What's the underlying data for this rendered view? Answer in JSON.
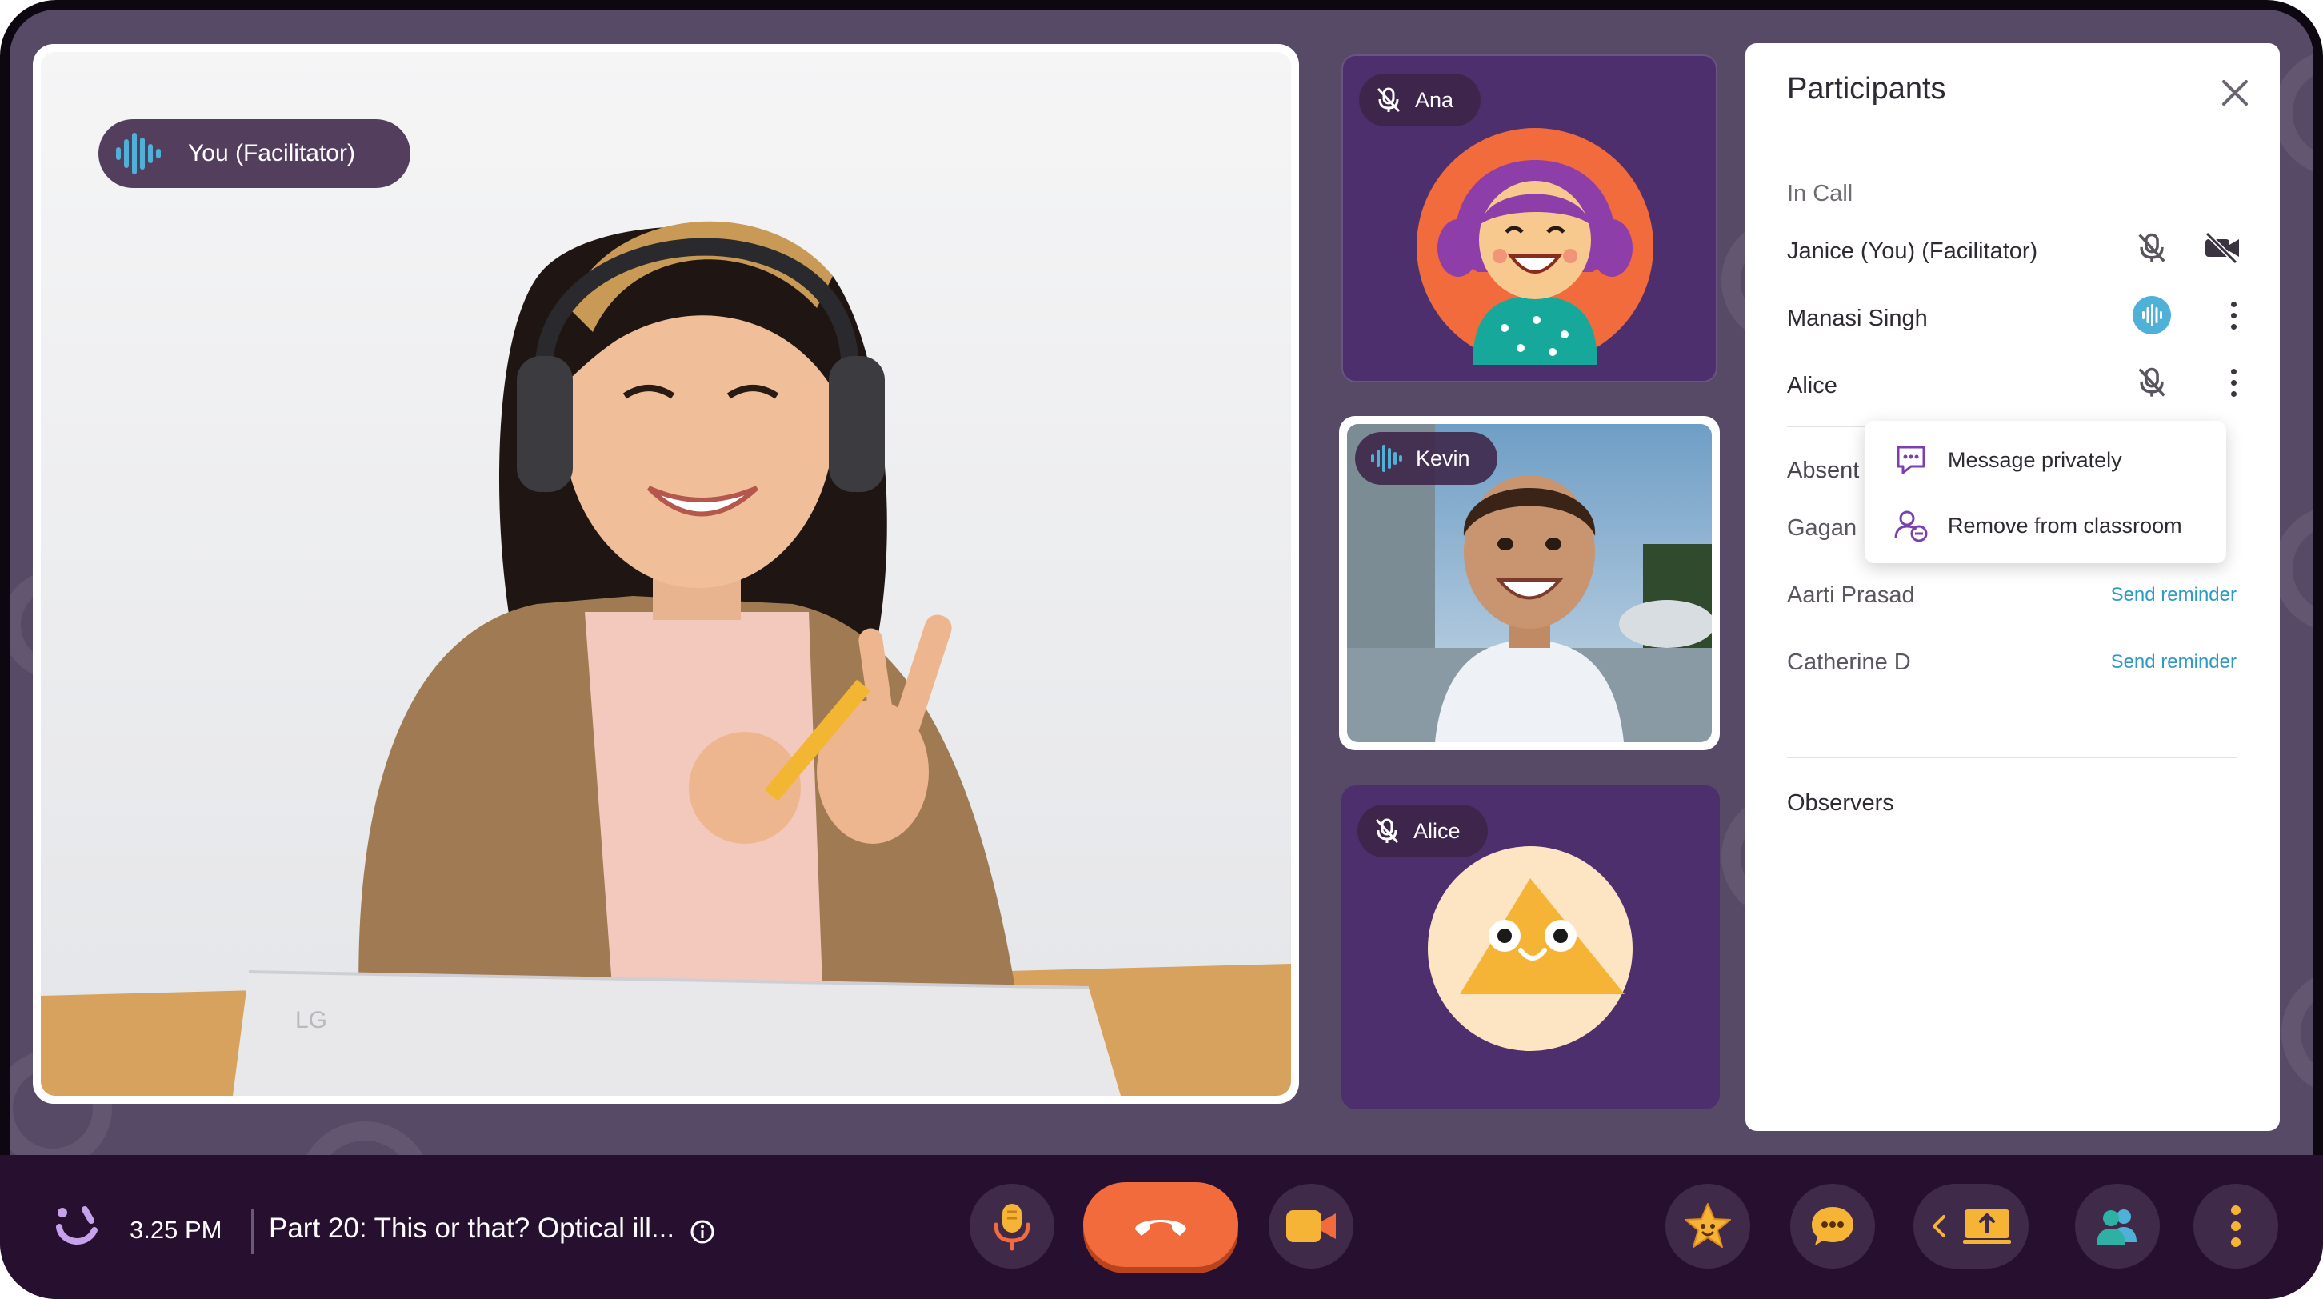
{
  "main_video": {
    "name_label": "You (Facilitator)",
    "laptop_brand": "LG"
  },
  "tiles": [
    {
      "name": "Ana",
      "status": "muted"
    },
    {
      "name": "Kevin",
      "status": "speaking"
    },
    {
      "name": "Alice",
      "status": "muted"
    }
  ],
  "participants_panel": {
    "title": "Participants",
    "in_call_label": "In Call",
    "in_call": [
      {
        "name": "Janice (You) (Facilitator)",
        "status": "muted"
      },
      {
        "name": "Manasi Singh",
        "status": "speaking"
      },
      {
        "name": "Alice",
        "status": "muted"
      }
    ],
    "absent_label": "Absent",
    "absent": [
      {
        "name": "Gagan",
        "action": ""
      },
      {
        "name": "Aarti Prasad",
        "action": "Send reminder"
      },
      {
        "name": "Catherine D",
        "action": "Send reminder"
      }
    ],
    "observers_label": "Observers"
  },
  "context_menu": {
    "items": [
      {
        "label": "Message privately",
        "icon": "chat-bubble-icon"
      },
      {
        "label": "Remove from classroom",
        "icon": "remove-user-icon"
      }
    ]
  },
  "bottom_bar": {
    "time": "3.25 PM",
    "lesson_title": "Part 20: This or that? Optical ill...",
    "buttons": [
      "microphone",
      "end-call",
      "camera",
      "star",
      "chat",
      "share-screen",
      "participants",
      "more"
    ]
  },
  "colors": {
    "accent_orange": "#f26b3c",
    "panel_bg": "#ffffff",
    "bar_bg": "#27102f",
    "stage_bg": "#574a67",
    "tile_purple": "#4c2f6c",
    "link_blue": "#2f9ac4"
  }
}
